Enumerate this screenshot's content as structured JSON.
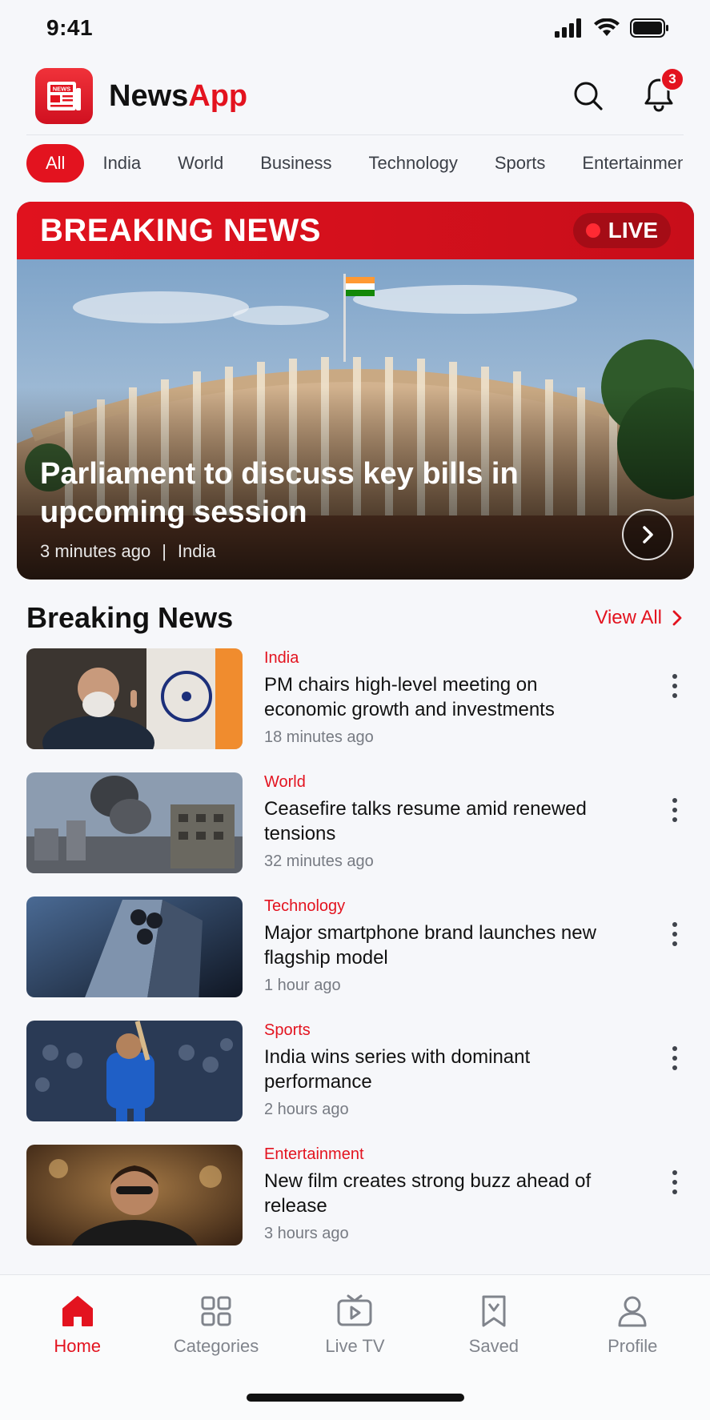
{
  "status_bar": {
    "time": "9:41"
  },
  "header": {
    "brand_part1": "News",
    "brand_part2": "App",
    "logo_text": "NEWS",
    "notification_count": "3"
  },
  "tabs": [
    "All",
    "India",
    "World",
    "Business",
    "Technology",
    "Sports",
    "Entertainment"
  ],
  "hero": {
    "banner_title": "BREAKING NEWS",
    "live_label": "LIVE",
    "headline": "Parliament to discuss key bills in upcoming session",
    "time": "3 minutes ago",
    "separator": "|",
    "category": "India"
  },
  "section": {
    "title": "Breaking News",
    "view_all": "View All"
  },
  "articles": [
    {
      "category": "India",
      "title": "PM chairs high-level meeting on economic growth and investments",
      "time": "18 minutes ago"
    },
    {
      "category": "World",
      "title": "Ceasefire talks resume amid renewed tensions",
      "time": "32 minutes ago"
    },
    {
      "category": "Technology",
      "title": "Major smartphone brand launches new flagship model",
      "time": "1 hour ago"
    },
    {
      "category": "Sports",
      "title": "India wins series with dominant performance",
      "time": "2 hours ago"
    },
    {
      "category": "Entertainment",
      "title": "New film creates strong buzz ahead of release",
      "time": "3 hours ago"
    }
  ],
  "bottom_nav": [
    {
      "label": "Home",
      "icon": "home-icon"
    },
    {
      "label": "Categories",
      "icon": "grid-icon"
    },
    {
      "label": "Live TV",
      "icon": "tv-play-icon"
    },
    {
      "label": "Saved",
      "icon": "bookmark-icon"
    },
    {
      "label": "Profile",
      "icon": "user-icon"
    }
  ],
  "colors": {
    "accent": "#e3131f",
    "text": "#111111",
    "muted": "#777b83"
  }
}
